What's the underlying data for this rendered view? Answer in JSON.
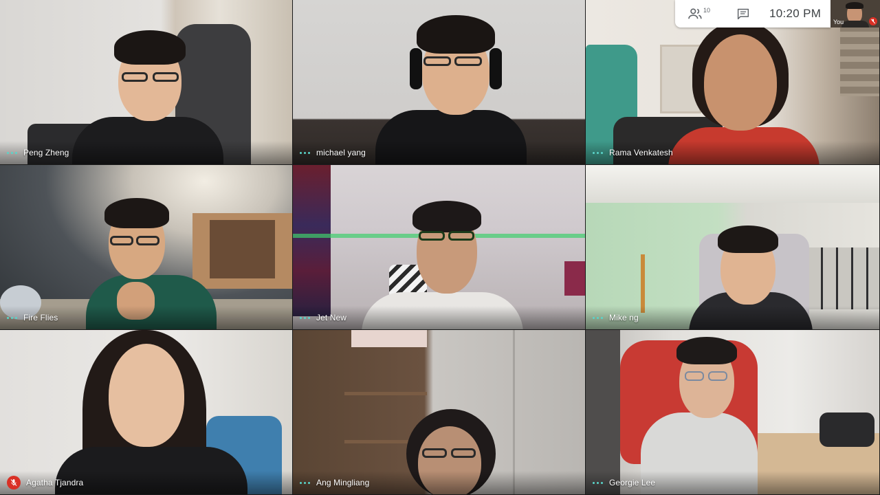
{
  "topbar": {
    "people_count": "10",
    "clock": "10:20 PM"
  },
  "self_view": {
    "label": "You",
    "mic_muted": true
  },
  "participants": [
    {
      "name": "Peng Zheng",
      "mic_muted": false
    },
    {
      "name": "michael yang",
      "mic_muted": false
    },
    {
      "name": "Rama Venkatesh",
      "mic_muted": false
    },
    {
      "name": "Fire Flies",
      "mic_muted": false
    },
    {
      "name": "Jet New",
      "mic_muted": false
    },
    {
      "name": "Mike ng",
      "mic_muted": false
    },
    {
      "name": "Agatha Tjandra",
      "mic_muted": true
    },
    {
      "name": "Ang Mingliang",
      "mic_muted": false
    },
    {
      "name": "Georgie Lee",
      "mic_muted": false
    }
  ],
  "colors": {
    "activity_dots": "#5ad4c9",
    "mic_muted_red": "#d93025",
    "topbar_bg": "#ffffff"
  },
  "icons": {
    "people": "people-icon",
    "chat": "chat-icon",
    "mic_off": "mic-off-icon",
    "more_options": "more-options-icon"
  }
}
